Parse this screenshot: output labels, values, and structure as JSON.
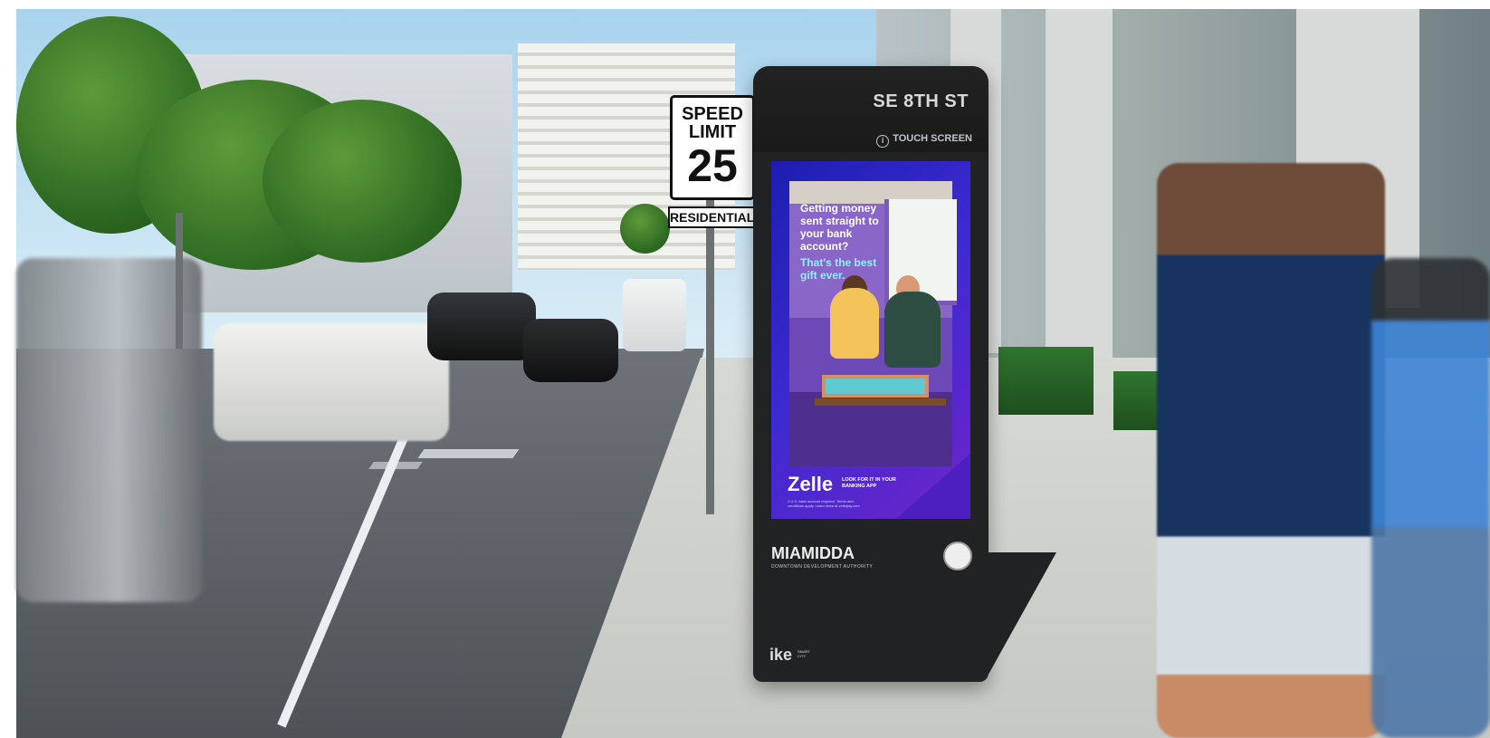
{
  "scene": {
    "kiosk": {
      "street_name": "SE 8TH ST",
      "touch_text": "TOUCH SCREEN",
      "ad_headline": "Getting money sent straight to your bank account?",
      "ad_subline": "That's the best gift ever.",
      "brand": "Zelle",
      "brand_note": "LOOK FOR IT IN YOUR BANKING APP",
      "fine_print": "1 U.S. bank account required. Terms and conditions apply. Learn more at zellepay.com",
      "authority_name": "MIAMIDDA",
      "authority_subtitle": "DOWNTOWN DEVELOPMENT AUTHORITY",
      "footer_brand": "ike",
      "footer_subtitle": "SMART CITY"
    },
    "speed_sign": {
      "top": "SPEED",
      "middle": "LIMIT",
      "value": "25",
      "subsign": "RESIDENTIAL"
    },
    "colors": {
      "screen_primary": "#3e2ad2",
      "screen_secondary": "#6e24c9",
      "highlight": "#8ef0ff",
      "kiosk_body": "#202224"
    }
  }
}
